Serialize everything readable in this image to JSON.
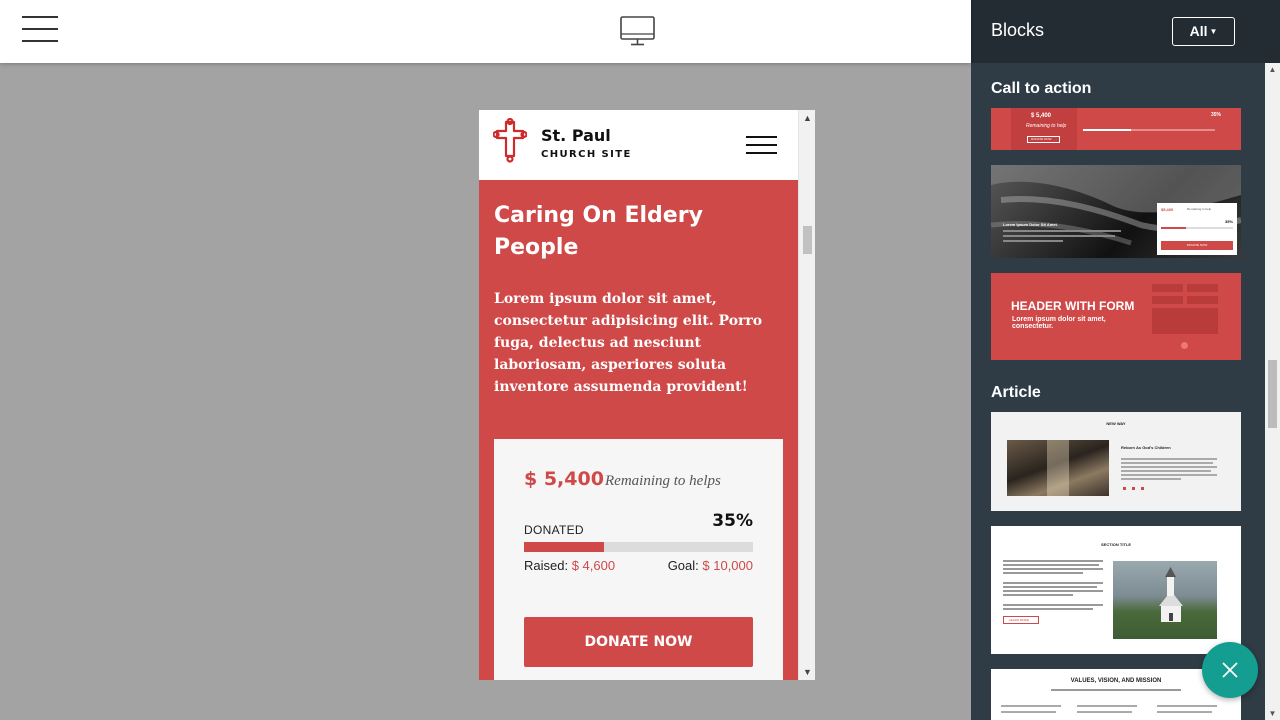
{
  "toolbar": {
    "menu_icon": "hamburger-menu-icon",
    "device_icon": "desktop-monitor-icon"
  },
  "preview": {
    "site": {
      "name": "St. Paul",
      "subtitle": "CHURCH SITE",
      "logo_icon": "cross-icon",
      "menu_icon": "hamburger-menu-icon"
    },
    "hero": {
      "title": "Caring On Eldery People",
      "text": "Lorem ipsum dolor sit amet, consectetur adipisicing elit. Porro fuga, delectus ad nesciunt laboriosam, asperiores soluta inventore assumenda provident!"
    },
    "donation": {
      "amount": "$ 5,400",
      "remaining_label": "Remaining to helps",
      "donated_label": "DONATED",
      "percent_text": "35%",
      "progress": 0.35,
      "raised_label": "Raised:",
      "raised_value": "$ 4,600",
      "goal_label": "Goal:",
      "goal_value": "$ 10,000",
      "button_label": "DONATE NOW"
    }
  },
  "sidebar": {
    "title": "Blocks",
    "filter_label": "All",
    "sections": [
      {
        "label": "Call to action",
        "thumbs": [
          {
            "name": "cta-progress-thumb",
            "amount": "$ 5,400",
            "remaining": "Remaining to help",
            "percent": "35%",
            "button": "DONATE NOW"
          },
          {
            "name": "cta-hands-thumb",
            "heading": "Lorem Ipsum Dolor Sit Amet.",
            "amount": "$5,400",
            "remaining": "Remaining to help",
            "percent": "35%",
            "button": "DONATE NOW"
          },
          {
            "name": "header-with-form-thumb",
            "heading": "HEADER WITH FORM",
            "sub": "Lorem ipsum dolor sit amet, consectetur."
          }
        ]
      },
      {
        "label": "Article",
        "thumbs": [
          {
            "name": "article-new-way-thumb",
            "heading": "NEW WAY",
            "subheading": "Reborn As God's Children"
          },
          {
            "name": "article-section-title-thumb",
            "heading": "SECTION TITLE",
            "button": "LEARN MORE"
          },
          {
            "name": "article-values-thumb",
            "heading": "VALUES, VISION, AND MISSION"
          }
        ]
      }
    ]
  },
  "fab": {
    "icon": "close-icon"
  },
  "colors": {
    "accent_red": "#cf4948",
    "sidebar_bg": "#2f3c45",
    "fab_teal": "#149d91"
  }
}
